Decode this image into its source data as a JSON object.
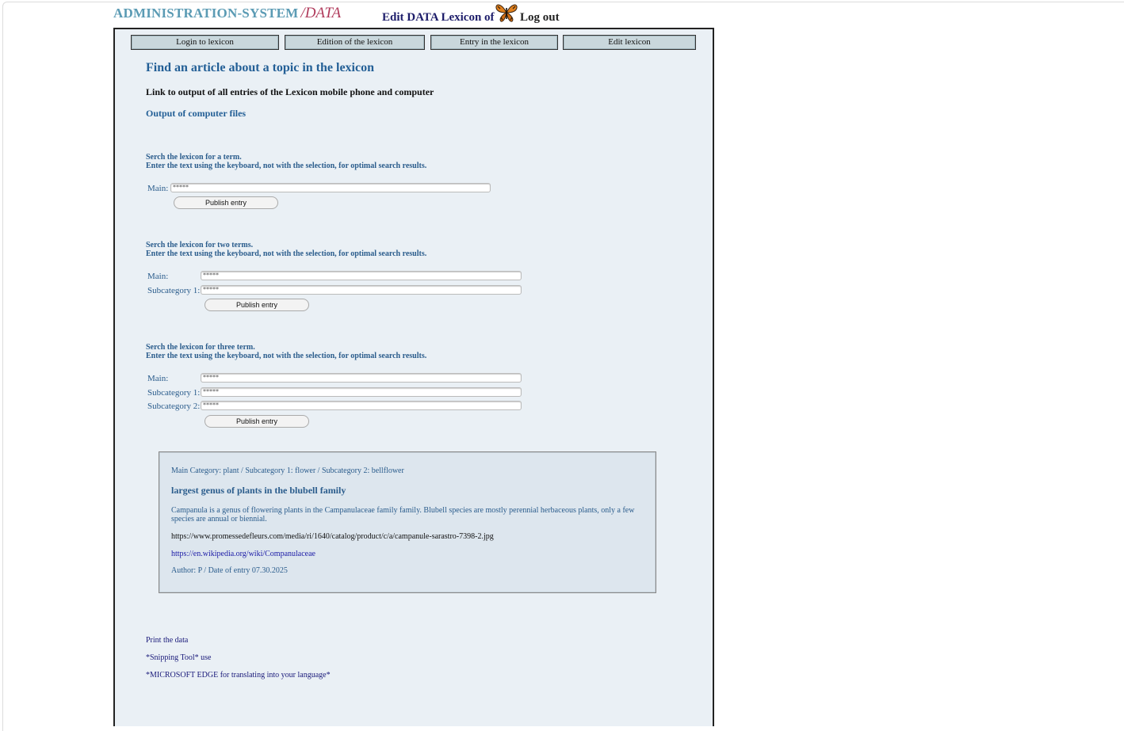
{
  "header": {
    "brand_main": "ADMINISTRATION-SYSTEM",
    "brand_sub": "/DATA",
    "edit_label": "Edit DATA Lexicon of",
    "logout_label": "Log out",
    "butterfly_icon": "butterfly-icon"
  },
  "nav": {
    "login": "Login to lexicon",
    "edition": "Edition of the lexicon",
    "entry": "Entry in the lexicon",
    "edit": "Edit lexicon"
  },
  "main": {
    "title": "Find an article about a topic in the lexicon",
    "link_text": "Link to output of all entries of the Lexicon mobile phone and computer",
    "output_files": "Output of computer files"
  },
  "search1": {
    "heading1": "Serch the lexicon for a term.",
    "heading2": "Enter the text using the keyboard, not with the selection, for optimal search results.",
    "main_label": "Main:",
    "main_value": "*****",
    "button": "Publish entry"
  },
  "search2": {
    "heading1": "Serch the lexicon for two terms.",
    "heading2": "Enter the text using the keyboard, not with the selection, for optimal search results.",
    "main_label": "Main:",
    "main_value": "*****",
    "sub1_label": "Subcategory 1:",
    "sub1_value": "*****",
    "button": "Publish entry"
  },
  "search3": {
    "heading1": "Serch the lexicon for three term.",
    "heading2": "Enter the text using the keyboard, not with the selection, for optimal search results.",
    "main_label": "Main:",
    "main_value": "*****",
    "sub1_label": "Subcategory 1:",
    "sub1_value": "*****",
    "sub2_label": "Subcategory 2:",
    "sub2_value": "*****",
    "button": "Publish entry"
  },
  "result": {
    "category": "Main Category: plant / Subcategory 1: flower / Subcategory 2: bellflower",
    "title": "largest genus of plants in the blubell family",
    "description": "Campanula is a genus of flowering plants in the Campanulaceae family family. Blubell species are mostly perennial herbaceous plants, only a few species are annual or biennial.",
    "url1": "https://www.promessedefleurs.com/media/ri/1640/catalog/product/c/a/campanule-sarastro-7398-2.jpg",
    "url2": "https://en.wikipedia.org/wiki/Companulaceae",
    "author": "Author: P / Date of entry 07.30.2025"
  },
  "footer": {
    "print": "Print the data",
    "snipping": "*Snipping Tool* use",
    "edge": "*MICROSOFT EDGE for translating into your language*"
  },
  "colors": {
    "brand_main": "#5b9bb4",
    "brand_sub": "#b03a5b",
    "panel_bg": "#eaf0f5",
    "title": "#235f96",
    "nav_button": "#c9d7dc"
  }
}
